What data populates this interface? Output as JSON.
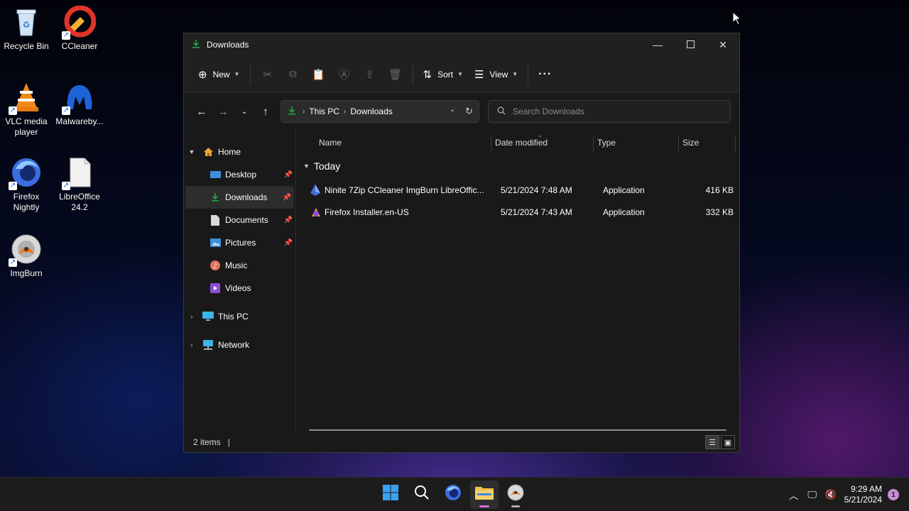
{
  "desktop": {
    "icons": [
      {
        "label": "Recycle Bin",
        "icon": "recycle-bin-icon"
      },
      {
        "label": "CCleaner",
        "icon": "ccleaner-icon"
      },
      {
        "label": "VLC media player",
        "icon": "vlc-icon"
      },
      {
        "label": "Malwareby...",
        "icon": "malwarebytes-icon"
      },
      {
        "label": "Firefox Nightly",
        "icon": "firefox-nightly-icon"
      },
      {
        "label": "LibreOffice 24.2",
        "icon": "libreoffice-icon"
      },
      {
        "label": "ImgBurn",
        "icon": "imgburn-icon"
      }
    ]
  },
  "window": {
    "title": "Downloads",
    "colors": {
      "accent": "#1fa64a",
      "folder_blue": "#3c8fdc"
    }
  },
  "toolbar": {
    "new_label": "New",
    "sort_label": "Sort",
    "view_label": "View",
    "more_label": "···"
  },
  "address": {
    "crumbs": [
      "This PC",
      "Downloads"
    ],
    "search_placeholder": "Search Downloads"
  },
  "navpane": {
    "home": "Home",
    "quick": [
      {
        "label": "Desktop",
        "pinned": true
      },
      {
        "label": "Downloads",
        "pinned": true
      },
      {
        "label": "Documents",
        "pinned": true
      },
      {
        "label": "Pictures",
        "pinned": true
      },
      {
        "label": "Music",
        "pinned": false
      },
      {
        "label": "Videos",
        "pinned": false
      }
    ],
    "this_pc": "This PC",
    "network": "Network"
  },
  "columns": {
    "name": "Name",
    "date": "Date modified",
    "type": "Type",
    "size": "Size"
  },
  "group": {
    "label": "Today"
  },
  "files": [
    {
      "name": "Ninite 7Zip CCleaner ImgBurn LibreOffic...",
      "date": "5/21/2024 7:48 AM",
      "type": "Application",
      "size": "416 KB"
    },
    {
      "name": "Firefox Installer.en-US",
      "date": "5/21/2024 7:43 AM",
      "type": "Application",
      "size": "332 KB"
    }
  ],
  "status": {
    "count": "2 items",
    "bar": "|"
  },
  "taskbar": {
    "time": "9:29 AM",
    "date": "5/21/2024",
    "notification_count": "1"
  }
}
